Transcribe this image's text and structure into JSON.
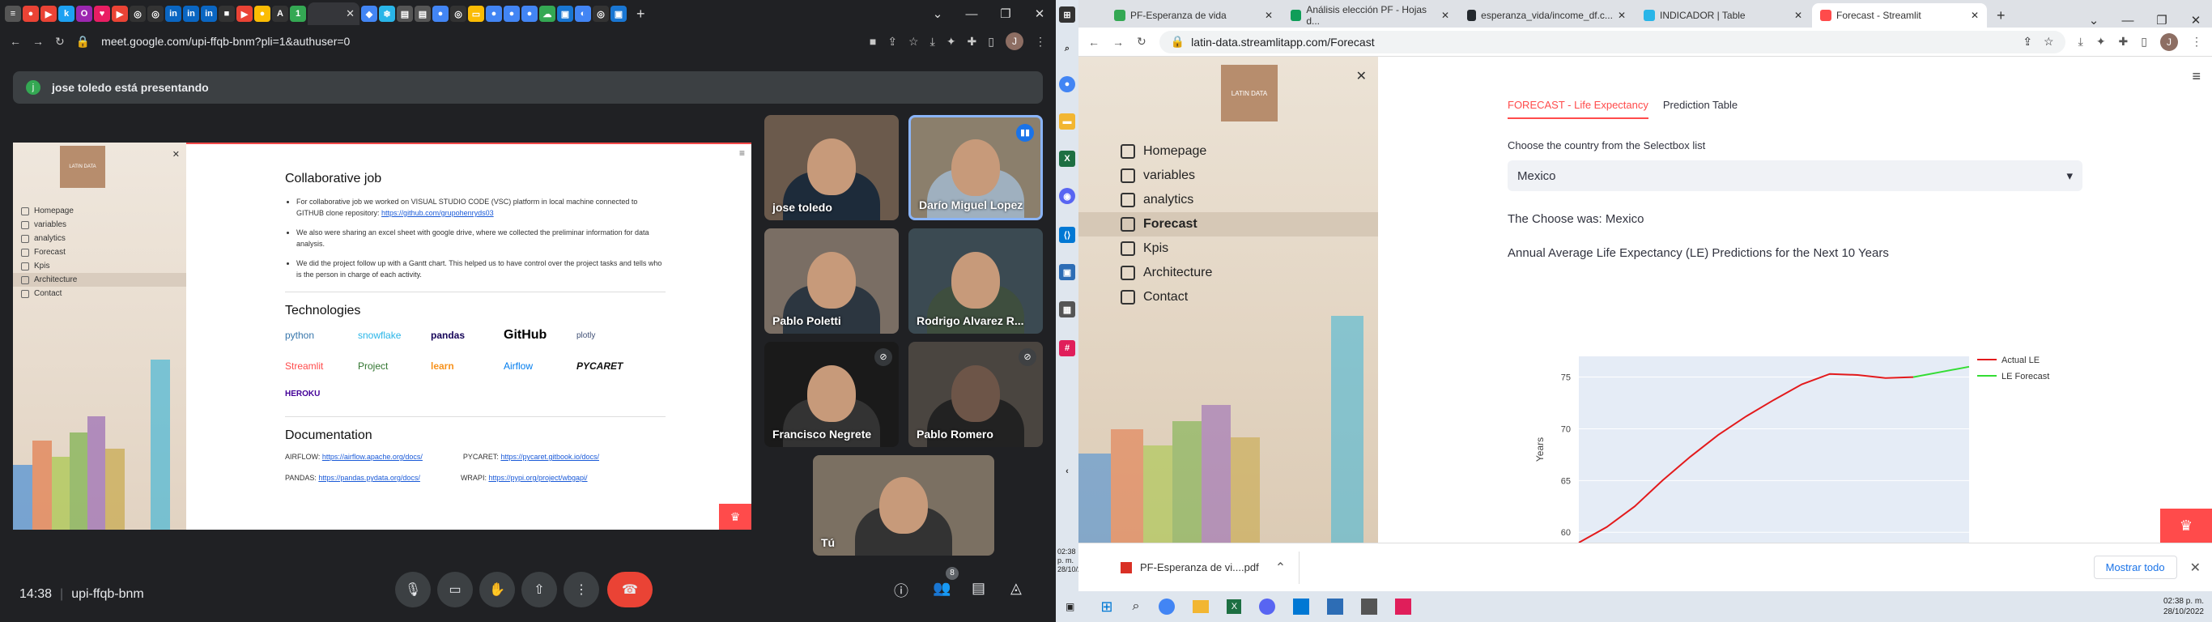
{
  "meet": {
    "url": "meet.google.com/upi-ffqb-bnm?pli=1&authuser=0",
    "presenter_initial": "j",
    "presenter_banner": "jose toledo está presentando",
    "time": "14:38",
    "meeting_code": "upi-ffqb-bnm",
    "participants_badge": "8",
    "slide": {
      "sidebar": [
        "Homepage",
        "variables",
        "analytics",
        "Forecast",
        "Kpis",
        "Architecture",
        "Contact"
      ],
      "sidebar_selected": "Architecture",
      "logo_text": "LATIN DATA",
      "h_collab": "Collaborative job",
      "bullets": [
        {
          "text": "For collaborative job we worked on VISUAL STUDIO CODE (VSC) platform in local machine connected to GITHUB clone repository: ",
          "link": "https://github.com/grupohenryds03"
        },
        {
          "text": "We also were sharing an excel sheet with google drive, where we collected the preliminar information for data analysis.",
          "link": ""
        },
        {
          "text": "We did the project follow up with a Gantt chart. This helped us to have control over the project tasks and tells who is the person in charge of each activity.",
          "link": ""
        }
      ],
      "h_tech": "Technologies",
      "logos": [
        "python",
        "snowflake",
        "pandas",
        "GitHub",
        "plotly",
        "Streamlit",
        "Project",
        "learn",
        "Airflow",
        "PYCARET",
        "HEROKU"
      ],
      "h_docs": "Documentation",
      "docs": [
        {
          "label": "AIRFLOW: ",
          "link": "https://airflow.apache.org/docs/"
        },
        {
          "label": "PYCARET: ",
          "link": "https://pycaret.gitbook.io/docs/"
        },
        {
          "label": "PANDAS: ",
          "link": "https://pandas.pydata.org/docs/"
        },
        {
          "label": "WRAPI: ",
          "link": "https://pypi.org/project/wbgapi/"
        }
      ]
    },
    "tiles": [
      {
        "name": "jose toledo"
      },
      {
        "name": "Darío Miguel Lopez"
      },
      {
        "name": "Pablo Poletti"
      },
      {
        "name": "Rodrigo Alvarez R..."
      },
      {
        "name": "Francisco Negrete"
      },
      {
        "name": "Pablo Romero"
      },
      {
        "name": "Tú"
      }
    ]
  },
  "streamlit": {
    "tabs": [
      {
        "title": "PF-Esperanza de vida"
      },
      {
        "title": "Análisis elección PF - Hojas d..."
      },
      {
        "title": "esperanza_vida/income_df.c..."
      },
      {
        "title": "INDICADOR | Table"
      },
      {
        "title": "Forecast - Streamlit"
      }
    ],
    "url": "latin-data.streamlitapp.com/Forecast",
    "logo_text": "LATIN DATA",
    "sidebar": [
      "Homepage",
      "variables",
      "analytics",
      "Forecast",
      "Kpis",
      "Architecture",
      "Contact"
    ],
    "sidebar_selected": "Forecast",
    "tab1": "FORECAST - Life Expectancy",
    "tab2": "Prediction Table",
    "select_label": "Choose the country from the Selectbox list",
    "select_value": "Mexico",
    "chosen": "The Choose was: Mexico",
    "chart_title": "Annual Average Life Expectancy (LE) Predictions for the Next 10 Years",
    "download_name": "PF-Esperanza de vi....pdf",
    "show_all": "Mostrar todo",
    "clock_time": "02:38 p. m.",
    "clock_date": "28/10/2022"
  },
  "chart_data": {
    "type": "line",
    "ylabel": "Years",
    "yticks": [
      60,
      65,
      70,
      75
    ],
    "ylim": [
      59,
      77
    ],
    "series": [
      {
        "name": "Actual LE",
        "color": "#e31a1c",
        "points": [
          [
            0,
            59
          ],
          [
            1,
            60.5
          ],
          [
            2,
            62.5
          ],
          [
            3,
            65
          ],
          [
            4,
            67.3
          ],
          [
            5,
            69.4
          ],
          [
            6,
            71.2
          ],
          [
            7,
            72.8
          ],
          [
            8,
            74.3
          ],
          [
            9,
            75.3
          ],
          [
            10,
            75.2
          ],
          [
            11,
            74.9
          ],
          [
            12,
            75
          ]
        ]
      },
      {
        "name": "LE Forecast",
        "color": "#33dd33",
        "points": [
          [
            12,
            75
          ],
          [
            13,
            75.5
          ],
          [
            14,
            76
          ]
        ]
      }
    ],
    "legend_position": "right"
  }
}
